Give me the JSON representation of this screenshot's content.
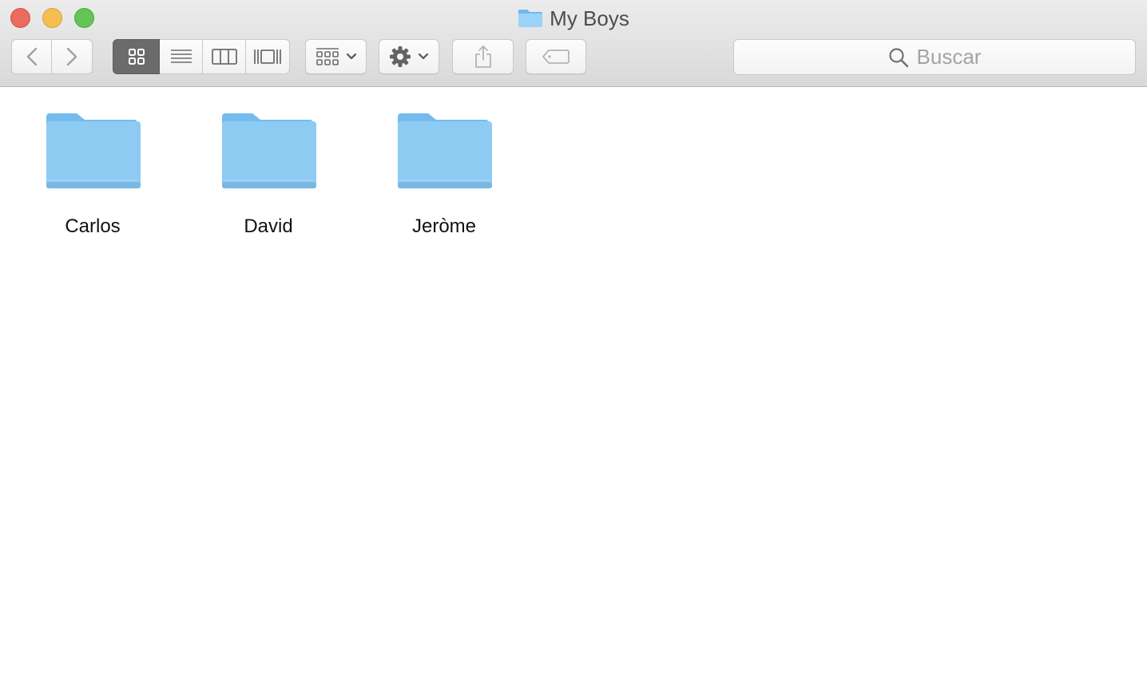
{
  "window": {
    "title": "My Boys",
    "folder_icon": "folder-icon"
  },
  "toolbar": {
    "back_icon": "chevron-left-icon",
    "forward_icon": "chevron-right-icon",
    "views": [
      {
        "name": "icon-view",
        "icon": "grid-icon",
        "selected": true
      },
      {
        "name": "list-view",
        "icon": "list-icon",
        "selected": false
      },
      {
        "name": "column-view",
        "icon": "columns-icon",
        "selected": false
      },
      {
        "name": "cover-flow-view",
        "icon": "cover-flow-icon",
        "selected": false
      }
    ],
    "arrange_icon": "arrange-grid-icon",
    "action_icon": "gear-icon",
    "share_icon": "share-icon",
    "tag_icon": "tag-icon"
  },
  "search": {
    "placeholder": "Buscar",
    "icon": "search-icon"
  },
  "items": [
    {
      "label": "Carlos",
      "icon": "folder-icon"
    },
    {
      "label": "David",
      "icon": "folder-icon"
    },
    {
      "label": "Jeròme",
      "icon": "folder-icon"
    }
  ],
  "colors": {
    "close": "#ed6a5e",
    "minimize": "#f5bf4f",
    "maximize": "#62c554",
    "folder": "#8ecbf3",
    "selected_view": "#6b6b6b"
  }
}
